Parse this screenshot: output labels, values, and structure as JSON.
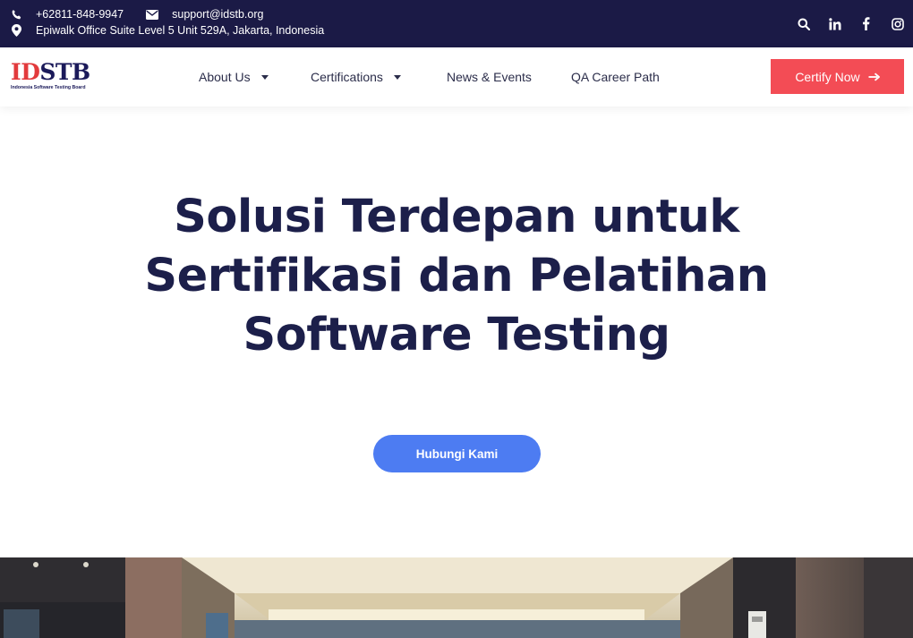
{
  "topbar": {
    "phone": "+62811-848-9947",
    "email": "support@idstb.org",
    "address": "Epiwalk Office Suite Level 5 Unit 529A, Jakarta, Indonesia",
    "icons": [
      "phone-icon",
      "envelope-icon",
      "map-marker-icon",
      "search-icon",
      "linkedin-icon",
      "facebook-icon",
      "instagram-icon"
    ]
  },
  "logo": {
    "id_part": "ID",
    "stb_part": "STB",
    "tagline": "Indonesia Software Testing Board"
  },
  "nav": {
    "items": [
      {
        "label": "About Us",
        "has_dropdown": true
      },
      {
        "label": "Certifications",
        "has_dropdown": true
      },
      {
        "label": "News & Events",
        "has_dropdown": false
      },
      {
        "label": "QA Career Path",
        "has_dropdown": false
      }
    ]
  },
  "cta": {
    "label": "Certify Now"
  },
  "hero": {
    "title": "Solusi Terdepan untuk Sertifikasi dan Pelatihan Software Testing",
    "button": "Hubungi Kami"
  },
  "colors": {
    "topbar_bg": "#1b1a46",
    "cta_bg": "#f34c55",
    "hero_title": "#1c1f4a",
    "hero_button": "#4d7cf2",
    "logo_red": "#e23a3c",
    "logo_navy": "#1b1a5a"
  }
}
